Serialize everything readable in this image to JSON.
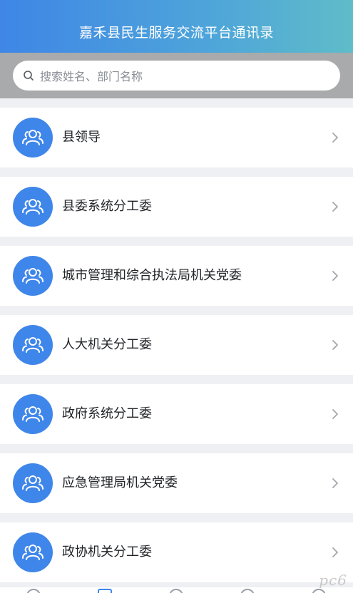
{
  "header": {
    "title": "嘉禾县民生服务交流平台通讯录"
  },
  "search": {
    "placeholder": "搜索姓名、部门名称",
    "icon": "search-icon"
  },
  "list": {
    "items": [
      {
        "label": "县领导",
        "icon": "group-icon"
      },
      {
        "label": "县委系统分工委",
        "icon": "group-icon"
      },
      {
        "label": "城市管理和综合执法局机关党委",
        "icon": "group-icon"
      },
      {
        "label": "人大机关分工委",
        "icon": "group-icon"
      },
      {
        "label": "政府系统分工委",
        "icon": "group-icon"
      },
      {
        "label": "应急管理局机关党委",
        "icon": "group-icon"
      },
      {
        "label": "政协机关分工委",
        "icon": "group-icon"
      }
    ]
  },
  "colors": {
    "header_gradient_start": "#3f86e6",
    "header_gradient_end": "#5fbcc9",
    "avatar": "#3f86ea",
    "search_strip": "#a9aaab",
    "page_bg": "#eef0f3"
  },
  "watermark": {
    "text": "pc6"
  }
}
